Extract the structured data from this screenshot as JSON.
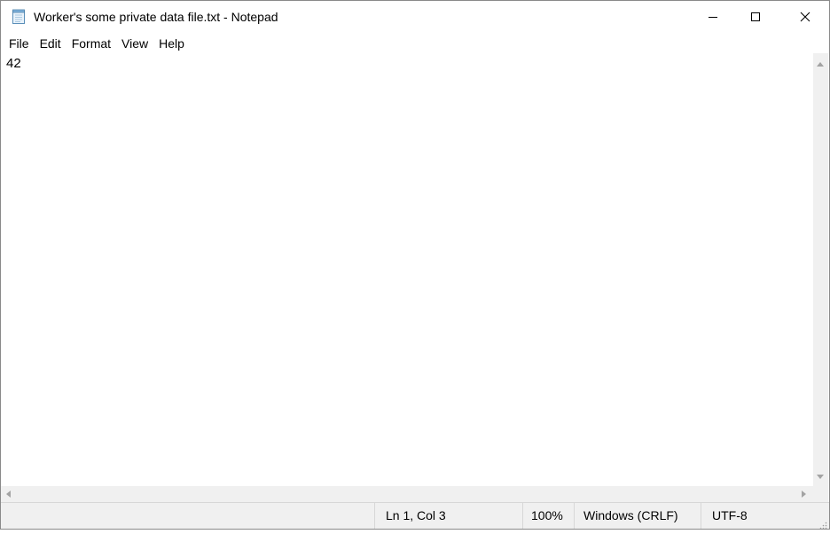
{
  "window": {
    "title": "Worker's some private data file.txt - Notepad",
    "icon": "notepad-icon"
  },
  "caption_buttons": {
    "minimize": "minimize-icon",
    "maximize": "maximize-icon",
    "close": "close-icon"
  },
  "menu": {
    "items": [
      {
        "label": "File"
      },
      {
        "label": "Edit"
      },
      {
        "label": "Format"
      },
      {
        "label": "View"
      },
      {
        "label": "Help"
      }
    ]
  },
  "editor": {
    "content": "42"
  },
  "statusbar": {
    "position": "Ln 1, Col 3",
    "zoom": "100%",
    "line_ending": "Windows (CRLF)",
    "encoding": "UTF-8"
  },
  "colors": {
    "chrome": "#f0f0f0",
    "text": "#000000",
    "scroll_arrow": "#a3a3a3"
  }
}
